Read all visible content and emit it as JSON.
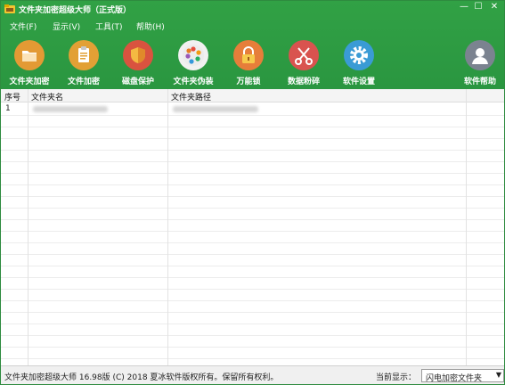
{
  "window": {
    "title": "文件夹加密超级大师（正式版）",
    "minimize": "—",
    "maximize": "☐",
    "close": "✕"
  },
  "menu": [
    "文件(F)",
    "显示(V)",
    "工具(T)",
    "帮助(H)"
  ],
  "toolbar": [
    {
      "label": "文件夹加密",
      "icon": "folder-icon",
      "color": "#e39a34"
    },
    {
      "label": "文件加密",
      "icon": "clipboard-icon",
      "color": "#e2a035"
    },
    {
      "label": "磁盘保护",
      "icon": "shield-icon",
      "color": "#d9533f"
    },
    {
      "label": "文件夹伪装",
      "icon": "colorwheel-icon",
      "color": "#f1f1f1"
    },
    {
      "label": "万能锁",
      "icon": "lock-icon",
      "color": "#e67e3a"
    },
    {
      "label": "数据粉碎",
      "icon": "scissors-icon",
      "color": "#d9534f"
    },
    {
      "label": "软件设置",
      "icon": "gear-icon",
      "color": "#3a9bd5"
    },
    {
      "label": "软件帮助",
      "icon": "user-icon",
      "color": "#7b8390"
    }
  ],
  "table": {
    "columns": [
      "序号",
      "文件夹名",
      "文件夹路径"
    ],
    "rows": [
      {
        "index": "1"
      }
    ]
  },
  "status": {
    "text": "文件夹加密超级大师 16.98版 (C) 2018   夏冰软件版权所有。保留所有权利。",
    "display_label": "当前显示：",
    "display_value": "闪电加密文件夹"
  }
}
